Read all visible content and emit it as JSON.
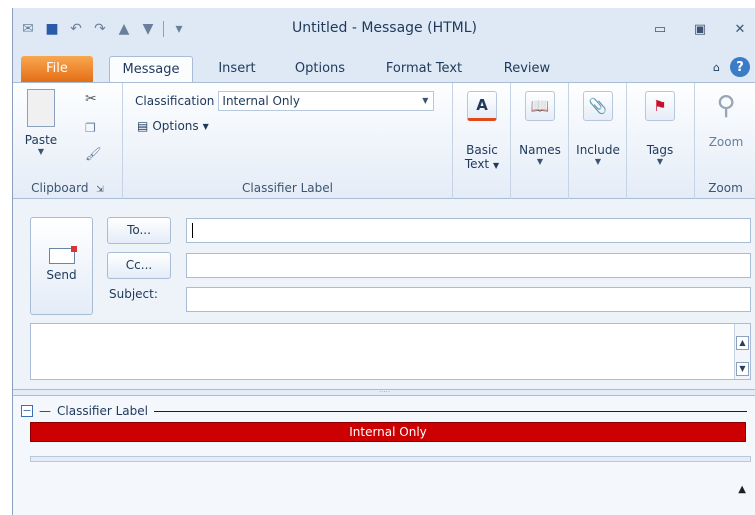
{
  "window": {
    "title": "Untitled  -  Message (HTML)"
  },
  "qat": {
    "icons": [
      "outlook-icon",
      "save-icon",
      "undo-icon",
      "redo-icon",
      "up-arrow-icon",
      "down-arrow-icon",
      "customize-icon"
    ]
  },
  "tabs": {
    "file": "File",
    "message": "Message",
    "insert": "Insert",
    "options": "Options",
    "format_text": "Format Text",
    "review": "Review"
  },
  "ribbon": {
    "clipboard": {
      "paste": "Paste",
      "label": "Clipboard"
    },
    "classifier": {
      "classification_label": "Classification",
      "classification_value": "Internal Only",
      "options": "Options",
      "label": "Classifier Label"
    },
    "basic_text": {
      "line1": "Basic",
      "line2": "Text"
    },
    "names": "Names",
    "include": "Include",
    "tags": "Tags",
    "zoom": {
      "button": "Zoom",
      "label": "Zoom"
    }
  },
  "compose": {
    "send": "Send",
    "to": "To...",
    "cc": "Cc...",
    "subject": "Subject:",
    "to_value": "",
    "cc_value": "",
    "subject_value": ""
  },
  "classifier_bar": {
    "title": "Classifier Label",
    "value": "Internal Only"
  },
  "colors": {
    "label_red": "#cc0000",
    "file_tab": "#e46f16"
  }
}
